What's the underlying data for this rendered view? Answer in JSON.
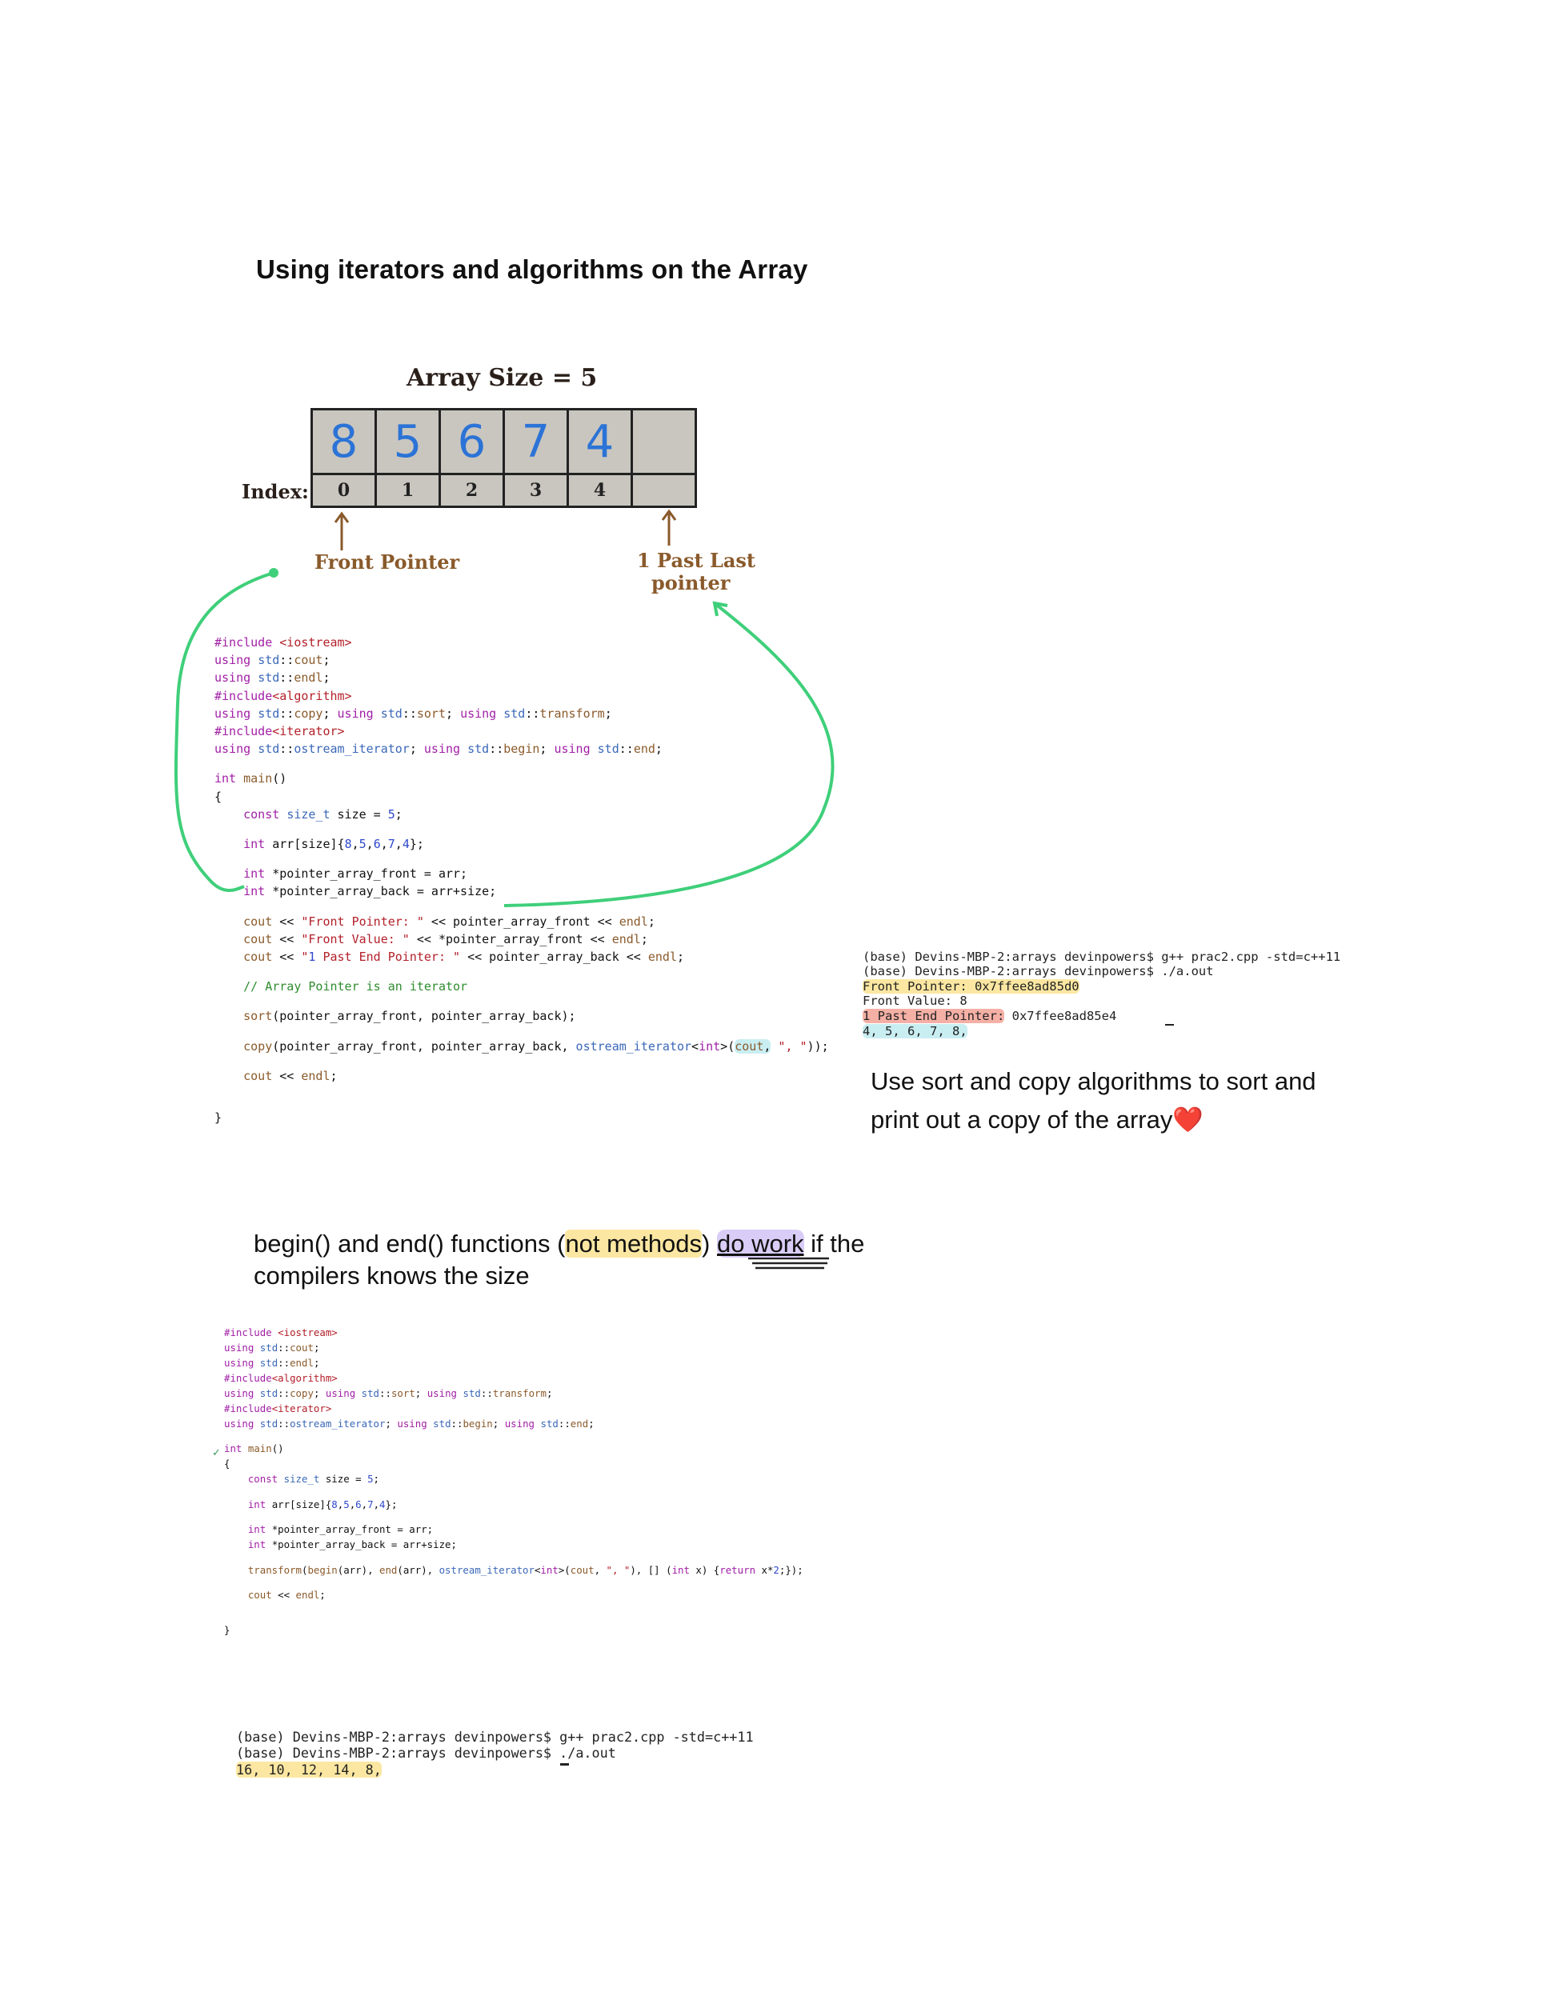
{
  "title": "Using iterators and algorithms on the Array",
  "diagram": {
    "array_size_label": "Array Size = 5",
    "index_label": "Index:",
    "values": [
      "8",
      "5",
      "6",
      "7",
      "4",
      ""
    ],
    "indices": [
      "0",
      "1",
      "2",
      "3",
      "4",
      ""
    ],
    "front_pointer_label": "Front Pointer",
    "past_last_label_line1": "1 Past Last",
    "past_last_label_line2": "pointer"
  },
  "code1_lines": [
    "#include <iostream>",
    "using std::cout;",
    "using std::endl;",
    "#include<algorithm>",
    "using std::copy; using std::sort; using std::transform;",
    "#include<iterator>",
    "using std::ostream_iterator; using std::begin; using std::end;",
    "",
    "int main()",
    "{",
    "    const size_t size = 5;",
    "",
    "    int arr[size]{8,5,6,7,4};",
    "",
    "    int *pointer_array_front = arr;",
    "    int *pointer_array_back = arr+size;",
    "",
    "    cout << \"Front Pointer: \" << pointer_array_front << endl;",
    "    cout << \"Front Value: \" << *pointer_array_front << endl;",
    "    cout << \"1 Past End Pointer: \" << pointer_array_back << endl;",
    "",
    "    // Array Pointer is an iterator",
    "",
    "    sort(pointer_array_front, pointer_array_back);",
    "",
    "    copy(pointer_array_front, pointer_array_back, ostream_iterator<int>(cout, \", \"));",
    "",
    "    cout << endl;",
    "",
    "",
    "}"
  ],
  "terminal1": {
    "line1": "(base) Devins-MBP-2:arrays devinpowers$ g++ prac2.cpp -std=c++11",
    "line2": "(base) Devins-MBP-2:arrays devinpowers$ ./a.out",
    "line3": "Front Pointer: 0x7ffee8ad85d0",
    "line4": "Front Value: 8",
    "line5_label": "1 Past End Pointer:",
    "line5_value": " 0x7ffee8ad85e4",
    "line6": "4, 5, 6, 7, 8,"
  },
  "note1": "Use sort and copy algorithms to sort and print out a copy of the array",
  "note1_emoji": "❤️",
  "note2": {
    "part1": "begin() and end() functions (",
    "part2": "not methods",
    "part3": ") ",
    "part4": "do work",
    "part5": " if the compilers knows the size"
  },
  "code2_lines": [
    "#include <iostream>",
    "using std::cout;",
    "using std::endl;",
    "#include<algorithm>",
    "using std::copy; using std::sort; using std::transform;",
    "#include<iterator>",
    "using std::ostream_iterator; using std::begin; using std::end;",
    "",
    "int main()",
    "{",
    "    const size_t size = 5;",
    "",
    "    int arr[size]{8,5,6,7,4};",
    "",
    "    int *pointer_array_front = arr;",
    "    int *pointer_array_back = arr+size;",
    "",
    "    transform(begin(arr), end(arr), ostream_iterator<int>(cout, \", \"), [] (int x) {return x*2;});",
    "",
    "    cout << endl;",
    "",
    "",
    "}"
  ],
  "code2_marker": "✓",
  "terminal2": {
    "line1": "(base) Devins-MBP-2:arrays devinpowers$ g++ prac2.cpp -std=c++11",
    "line2": "(base) Devins-MBP-2:arrays devinpowers$ ./a.out",
    "line3": "16, 10, 12, 14, 8,"
  },
  "colors": {
    "arrow_green": "#3fcf7a",
    "pointer_brown": "#8a5a2b",
    "array_digits_blue": "#2b73d6",
    "highlight_yellow": "#fbe7a1",
    "highlight_red": "#f5b0a6",
    "highlight_cyan": "#c9eef2",
    "highlight_purple": "#d9cdf7"
  }
}
